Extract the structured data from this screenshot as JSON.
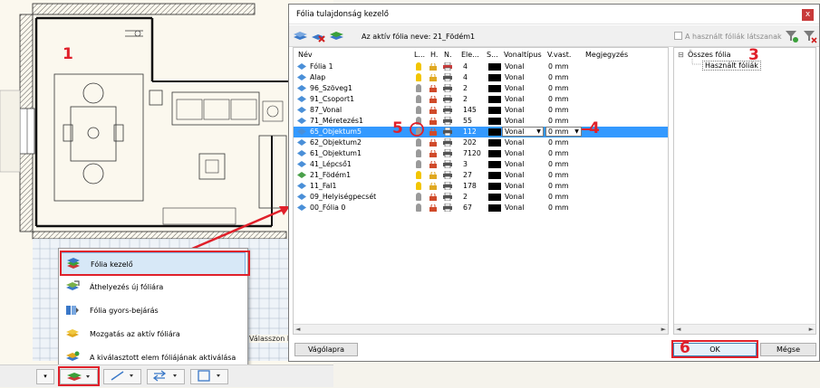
{
  "dialog": {
    "title": "Fólia tulajdonság kezelő",
    "close_glyph": "x",
    "active_layer_label": "Az aktív fólia neve: 21_Födém1",
    "show_used_label": "A használt fóliák látszanak",
    "clipboard_button": "Vágólapra",
    "ok_button": "OK",
    "cancel_button": "Mégse"
  },
  "table": {
    "headers": {
      "name": "Név",
      "visible": "L...",
      "lock": "H.",
      "print": "N.",
      "elements": "Ele...",
      "color": "S...",
      "linetype": "Vonaltípus",
      "linewidth": "V.vast.",
      "note": "Megjegyzés"
    },
    "rows": [
      {
        "name": "Fólia 1",
        "elements": "4",
        "linetype": "Vonal",
        "width": "0 mm",
        "bulb": "on",
        "lock": "open",
        "print": "off"
      },
      {
        "name": "Alap",
        "elements": "4",
        "linetype": "Vonal",
        "width": "0 mm",
        "bulb": "on",
        "lock": "open",
        "print": "on"
      },
      {
        "name": "96_Szöveg1",
        "elements": "2",
        "linetype": "Vonal",
        "width": "0 mm",
        "bulb": "off",
        "lock": "closed",
        "print": "on"
      },
      {
        "name": "91_Csoport1",
        "elements": "2",
        "linetype": "Vonal",
        "width": "0 mm",
        "bulb": "off",
        "lock": "closed",
        "print": "on"
      },
      {
        "name": "87_Vonal",
        "elements": "145",
        "linetype": "Vonal",
        "width": "0 mm",
        "bulb": "off",
        "lock": "closed",
        "print": "on"
      },
      {
        "name": "71_Méretezés1",
        "elements": "55",
        "linetype": "Vonal",
        "width": "0 mm",
        "bulb": "off",
        "lock": "closed",
        "print": "on"
      },
      {
        "name": "65_Objektum5",
        "elements": "112",
        "linetype": "Vonal",
        "width": "0 mm",
        "bulb": "off",
        "lock": "closed",
        "print": "on",
        "selected": true
      },
      {
        "name": "62_Objektum2",
        "elements": "202",
        "linetype": "Vonal",
        "width": "0 mm",
        "bulb": "off",
        "lock": "closed",
        "print": "on"
      },
      {
        "name": "61_Objektum1",
        "elements": "7120",
        "linetype": "Vonal",
        "width": "0 mm",
        "bulb": "off",
        "lock": "closed",
        "print": "on"
      },
      {
        "name": "41_Lépcső1",
        "elements": "3",
        "linetype": "Vonal",
        "width": "0 mm",
        "bulb": "off",
        "lock": "closed",
        "print": "on"
      },
      {
        "name": "21_Födém1",
        "elements": "27",
        "linetype": "Vonal",
        "width": "0 mm",
        "bulb": "on",
        "lock": "open",
        "print": "on",
        "active": true
      },
      {
        "name": "11_Fal1",
        "elements": "178",
        "linetype": "Vonal",
        "width": "0 mm",
        "bulb": "on",
        "lock": "open",
        "print": "on"
      },
      {
        "name": "09_Helyiségpecsét",
        "elements": "2",
        "linetype": "Vonal",
        "width": "0 mm",
        "bulb": "off",
        "lock": "closed",
        "print": "on"
      },
      {
        "name": "00_Fólia 0",
        "elements": "67",
        "linetype": "Vonal",
        "width": "0 mm",
        "bulb": "off",
        "lock": "closed",
        "print": "on"
      }
    ]
  },
  "tree": {
    "root_toggle": "⊟",
    "root": "Összes fólia",
    "child": "Használt fóliák"
  },
  "popup": {
    "items": [
      {
        "label": "Fólia kezelő",
        "icon": "layer-manager-icon"
      },
      {
        "label": "Áthelyezés új fóliára",
        "icon": "move-to-new-layer-icon"
      },
      {
        "label": "Fólia gyors-bejárás",
        "icon": "layer-walkthrough-icon"
      },
      {
        "label": "Mozgatás az aktív fóliára",
        "icon": "move-to-active-layer-icon"
      },
      {
        "label": "A kiválasztott elem fóliájának aktiválása",
        "icon": "activate-layer-icon"
      }
    ]
  },
  "cad": {
    "status_fragment": "Válasszon ki"
  },
  "markers": {
    "m1": "1",
    "m2": "2",
    "m3": "3",
    "m4": "4",
    "m5": "5",
    "m6": "6"
  },
  "scroll": {
    "left": "◄",
    "right": "►"
  },
  "colors": {
    "selection": "#3399ff",
    "annotation": "#e0202a",
    "layer_blue": "#4a8fd8",
    "bulb_on": "#f2c500",
    "lock_red": "#d04a2a"
  }
}
